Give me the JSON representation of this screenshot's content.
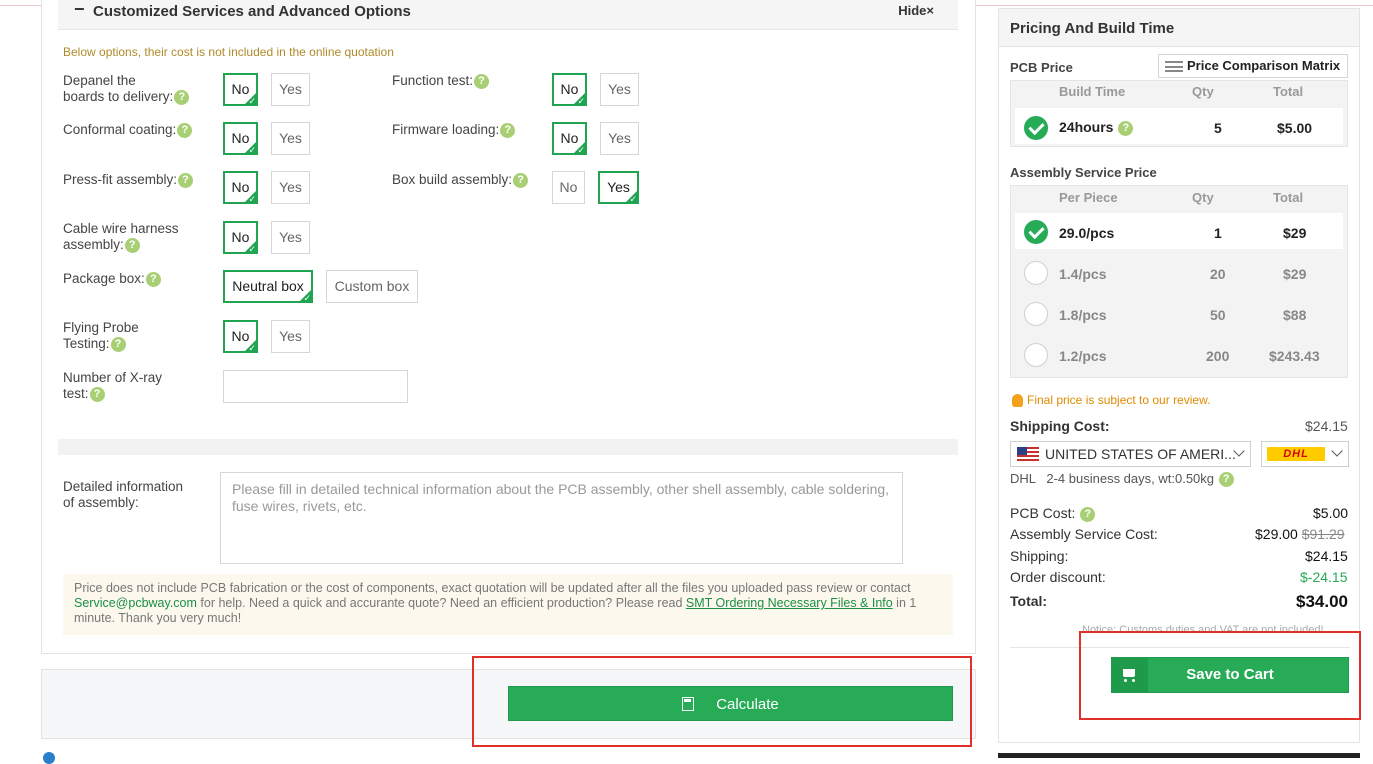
{
  "section": {
    "title": "Customized Services and Advanced Options",
    "hide": "Hide",
    "hide_icon": "×",
    "collapse_icon": "−"
  },
  "note": "Below options, their cost is not included in the online quotation",
  "options": {
    "depanel": {
      "label1": "Depanel the",
      "label2": "boards to delivery:",
      "no": "No",
      "yes": "Yes",
      "selected": "No"
    },
    "function_test": {
      "label": "Function test:",
      "no": "No",
      "yes": "Yes",
      "selected": "No"
    },
    "conformal": {
      "label": "Conformal coating:",
      "no": "No",
      "yes": "Yes",
      "selected": "No"
    },
    "firmware": {
      "label": "Firmware loading:",
      "no": "No",
      "yes": "Yes",
      "selected": "No"
    },
    "pressfit": {
      "label": "Press-fit assembly:",
      "no": "No",
      "yes": "Yes",
      "selected": "No"
    },
    "boxbuild": {
      "label": "Box build assembly:",
      "no": "No",
      "yes": "Yes",
      "selected": "Yes"
    },
    "cable": {
      "label1": "Cable wire harness",
      "label2": "assembly:",
      "no": "No",
      "yes": "Yes",
      "selected": "No"
    },
    "package": {
      "label": "Package box:",
      "neutral": "Neutral box",
      "custom": "Custom box",
      "selected": "Neutral box"
    },
    "flying": {
      "label1": "Flying Probe",
      "label2": "Testing:",
      "no": "No",
      "yes": "Yes",
      "selected": "No"
    },
    "xray": {
      "label1": "Number of X-ray",
      "label2": "test:",
      "value": ""
    }
  },
  "help_icon": "?",
  "detail": {
    "label1": "Detailed information",
    "label2": "of assembly:",
    "placeholder": "Please fill in detailed technical information about the PCB assembly, other shell assembly, cable soldering, fuse wires, rivets, etc."
  },
  "price_note": {
    "t1": "Price does not include PCB fabrication or the cost of components, exact quotation will be updated after all the files you uploaded pass review or contact ",
    "email": "Service@pcbway.com",
    "t2": " for help. Need a quick and accurante quote? Need an efficient production? Please read ",
    "link": "SMT Ordering Necessary Files & Info",
    "t3": " in 1 minute. Thank you very much!"
  },
  "calculate": "Calculate",
  "right": {
    "title": "Pricing And Build Time",
    "pcb_price": "PCB Price",
    "pcm": "Price Comparison Matrix",
    "pcb_headers": [
      "Build Time",
      "Qty",
      "Total"
    ],
    "pcb_row": {
      "time": "24hours",
      "qty": "5",
      "total": "$5.00"
    },
    "asm_title": "Assembly Service Price",
    "asm_headers": [
      "Per Piece",
      "Qty",
      "Total"
    ],
    "asm_rows": [
      {
        "per": "29.0/pcs",
        "qty": "1",
        "total": "$29",
        "selected": true
      },
      {
        "per": "1.4/pcs",
        "qty": "20",
        "total": "$29",
        "selected": false
      },
      {
        "per": "1.8/pcs",
        "qty": "50",
        "total": "$88",
        "selected": false
      },
      {
        "per": "1.2/pcs",
        "qty": "200",
        "total": "$243.43",
        "selected": false
      }
    ],
    "final_note": "Final price is subject to our review.",
    "shipping_cost_label": "Shipping Cost:",
    "shipping_cost": "$24.15",
    "country": "UNITED STATES OF AMERI...",
    "carrier": "DHL",
    "delivery": "DHL   2-4 business days, wt:0.50kg",
    "pcb_cost_label": "PCB Cost:",
    "pcb_cost": "$5.00",
    "asm_cost_label": "Assembly Service Cost:",
    "asm_cost": "$29.00",
    "asm_cost_old": "$91.29",
    "shipping_label": "Shipping:",
    "shipping": "$24.15",
    "discount_label": "Order discount:",
    "discount": "$-24.15",
    "total_label": "Total:",
    "total": "$34.00",
    "customs": "Notice: Customs duties and VAT are not included!",
    "save": "Save to Cart"
  },
  "colors": {
    "accent": "#27ab57",
    "highlight": "#e0302a",
    "note": "#b08a2a"
  }
}
